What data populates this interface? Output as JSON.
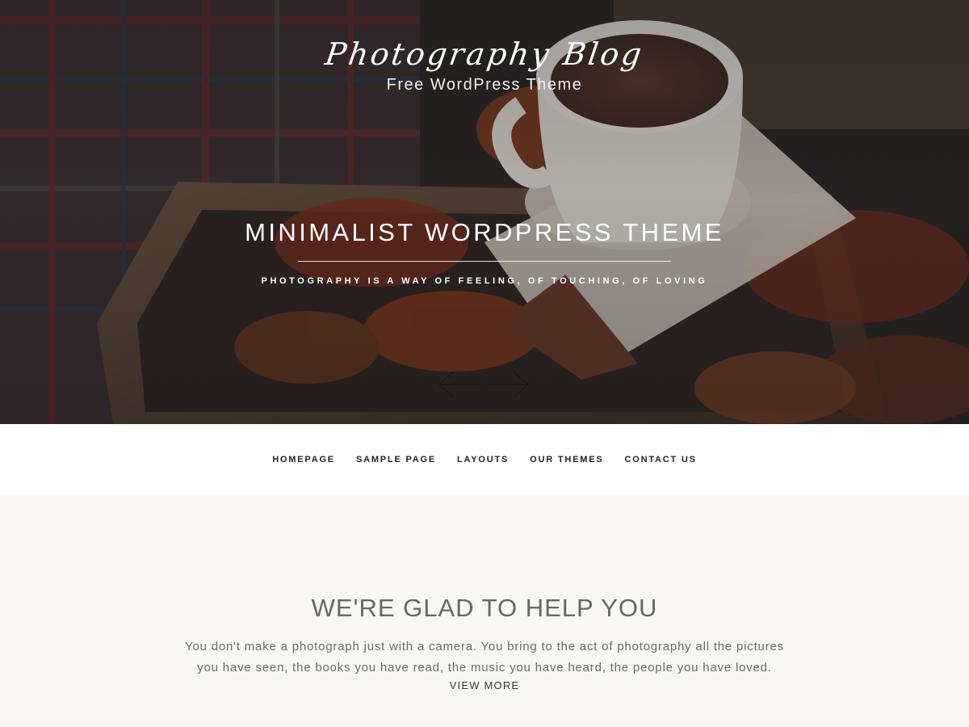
{
  "site": {
    "title": "Photography Blog",
    "tagline": "Free WordPress Theme"
  },
  "slider": {
    "title": "MINIMALIST WORDPRESS THEME",
    "subtitle": "PHOTOGRAPHY IS A WAY OF FEELING, OF TOUCHING, OF LOVING",
    "prev_icon": "arrow-left-icon",
    "next_icon": "arrow-right-icon"
  },
  "nav": {
    "items": [
      {
        "label": "HOMEPAGE"
      },
      {
        "label": "SAMPLE PAGE"
      },
      {
        "label": "LAYOUTS"
      },
      {
        "label": "OUR THEMES"
      },
      {
        "label": "CONTACT US"
      }
    ]
  },
  "section": {
    "heading": "WE'RE GLAD TO HELP YOU",
    "text": "You don't make a photograph just with a camera. You bring to the act of photography all the pictures you have seen, the books you have read, the music you have heard, the people you have loved.",
    "link": "VIEW MORE"
  },
  "colors": {
    "nav_bg": "#ffffff",
    "page_bg": "#f8f7f5",
    "heading": "#6b6664",
    "body_text": "#6e6967"
  }
}
